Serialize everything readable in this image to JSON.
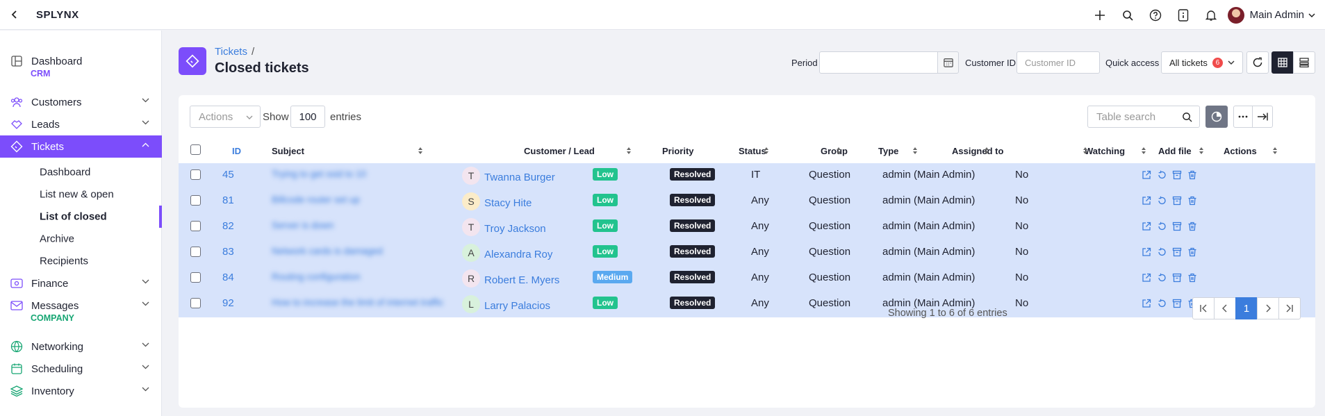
{
  "app": {
    "name": "SPLYNX",
    "user": "Main Admin"
  },
  "sidebar": {
    "items": [
      {
        "label": "Dashboard"
      },
      {
        "section": "CRM"
      },
      {
        "label": "Customers"
      },
      {
        "label": "Leads"
      },
      {
        "label": "Tickets"
      },
      {
        "label": "Finance"
      },
      {
        "label": "Messages"
      },
      {
        "section": "COMPANY"
      },
      {
        "label": "Networking"
      },
      {
        "label": "Scheduling"
      },
      {
        "label": "Inventory"
      }
    ],
    "tickets_sub": [
      "Dashboard",
      "List new & open",
      "List of closed",
      "Archive",
      "Recipients"
    ]
  },
  "page": {
    "breadcrumb": "Tickets",
    "breadcrumb_sep": "/",
    "title": "Closed tickets"
  },
  "filters": {
    "period_label": "Period",
    "period_value": "",
    "customer_id_label": "Customer ID",
    "customer_id_placeholder": "Customer ID",
    "quick_access_label": "Quick access",
    "quick_access_value": "All tickets",
    "quick_access_count": "6"
  },
  "toolbar": {
    "actions_label": "Actions",
    "show_label": "Show",
    "entries_value": "100",
    "entries_label": "entries",
    "search_placeholder": "Table search"
  },
  "table": {
    "headers": [
      "ID",
      "Subject",
      "Customer / Lead",
      "Priority",
      "Status",
      "Group",
      "Type",
      "Assigned to",
      "Watching",
      "Add file",
      "Actions"
    ],
    "rows": [
      {
        "id": "45",
        "subject": "Trying to get ssid to 10",
        "initial": "T",
        "customer": "Twanna Burger",
        "priority": "Low",
        "status": "Resolved",
        "group": "IT",
        "type": "Question",
        "assigned": "admin (Main Admin)",
        "watching": "No"
      },
      {
        "id": "81",
        "subject": "Billcode router set up",
        "initial": "S",
        "customer": "Stacy Hite",
        "priority": "Low",
        "status": "Resolved",
        "group": "Any",
        "type": "Question",
        "assigned": "admin (Main Admin)",
        "watching": "No"
      },
      {
        "id": "82",
        "subject": "Server is down",
        "initial": "T",
        "customer": "Troy Jackson",
        "priority": "Low",
        "status": "Resolved",
        "group": "Any",
        "type": "Question",
        "assigned": "admin (Main Admin)",
        "watching": "No"
      },
      {
        "id": "83",
        "subject": "Network cards is damaged",
        "initial": "A",
        "customer": "Alexandra Roy",
        "priority": "Low",
        "status": "Resolved",
        "group": "Any",
        "type": "Question",
        "assigned": "admin (Main Admin)",
        "watching": "No"
      },
      {
        "id": "84",
        "subject": "Routing configuration",
        "initial": "R",
        "customer": "Robert E. Myers",
        "priority": "Medium",
        "status": "Resolved",
        "group": "Any",
        "type": "Question",
        "assigned": "admin (Main Admin)",
        "watching": "No"
      },
      {
        "id": "92",
        "subject": "How to increase the limit of internet traffic",
        "initial": "L",
        "customer": "Larry Palacios",
        "priority": "Low",
        "status": "Resolved",
        "group": "Any",
        "type": "Question",
        "assigned": "admin (Main Admin)",
        "watching": "No"
      }
    ]
  },
  "footer": {
    "summary": "Showing 1 to 6 of 6 entries",
    "current_page": "1"
  },
  "colors": {
    "accent": "#7c4dfb",
    "link": "#3b7ddd",
    "low": "#22c38e",
    "medium": "#5aa9f0",
    "resolved": "#1f2230",
    "selected_row": "#d7e3fb"
  }
}
